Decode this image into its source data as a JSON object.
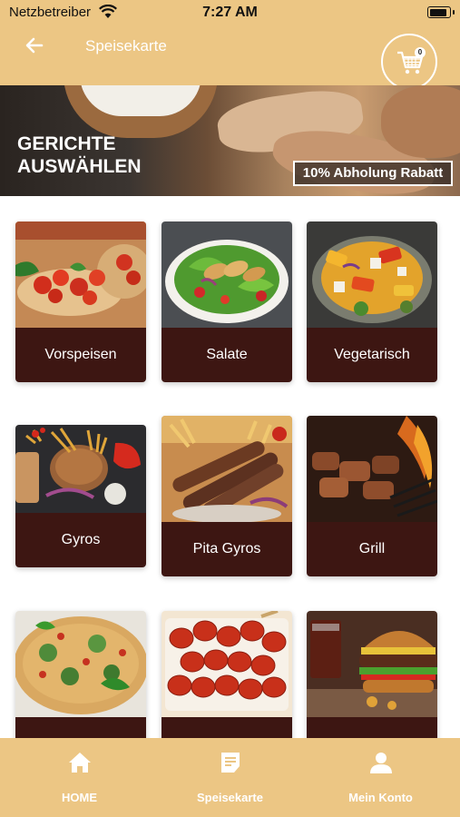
{
  "status_bar": {
    "carrier": "Netzbetreiber",
    "time": "7:27 AM"
  },
  "header": {
    "title": "Speisekarte",
    "cart_count": "0"
  },
  "hero": {
    "title": "GERICHTE AUSWÄHLEN",
    "badge": "10% Abholung Rabatt"
  },
  "categories": [
    {
      "label": "Vorspeisen",
      "image": "bruschetta-image"
    },
    {
      "label": "Salate",
      "image": "chicken-salad-image"
    },
    {
      "label": "Vegetarisch",
      "image": "grilled-vegetables-image"
    },
    {
      "label": "Gyros",
      "image": "gyros-plate-image"
    },
    {
      "label": "Pita Gyros",
      "image": "kebab-skewers-image"
    },
    {
      "label": "Grill",
      "image": "grilled-meat-image"
    },
    {
      "label": "",
      "image": "pizza-image"
    },
    {
      "label": "",
      "image": "currywurst-image"
    },
    {
      "label": "",
      "image": "burger-image"
    }
  ],
  "bottom_nav": [
    {
      "label": "HOME",
      "icon": "home-icon"
    },
    {
      "label": "Speisekarte",
      "icon": "menu-document-icon"
    },
    {
      "label": "Mein Konto",
      "icon": "user-icon"
    }
  ],
  "colors": {
    "header": "#ecc684",
    "card_label": "#3d1612",
    "text_light": "#ffffff"
  }
}
